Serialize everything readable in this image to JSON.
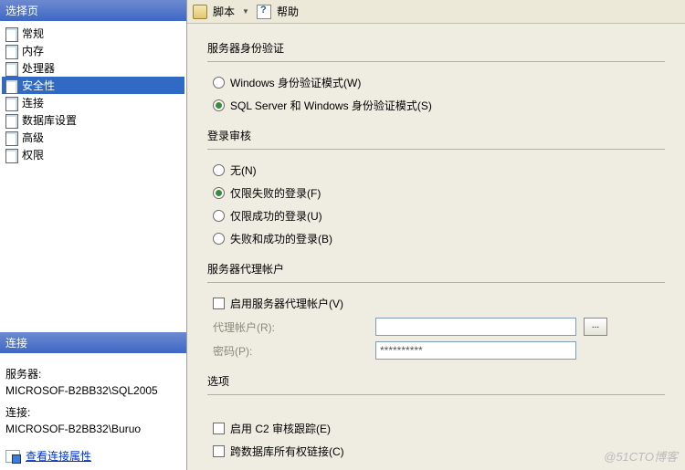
{
  "left": {
    "select_page_header": "选择页",
    "items": [
      "常规",
      "内存",
      "处理器",
      "安全性",
      "连接",
      "数据库设置",
      "高级",
      "权限"
    ],
    "selected_index": 3,
    "connect_header": "连接",
    "server_label": "服务器:",
    "server_value": "MICROSOF-B2BB32\\SQL2005",
    "conn_label": "连接:",
    "conn_value": "MICROSOF-B2BB32\\Buruo",
    "view_props": "查看连接属性"
  },
  "toolbar": {
    "script": "脚本",
    "help": "帮助"
  },
  "auth": {
    "title": "服务器身份验证",
    "windows": "Windows 身份验证模式(W)",
    "mixed": "SQL Server 和 Windows 身份验证模式(S)"
  },
  "audit": {
    "title": "登录审核",
    "none": "无(N)",
    "failed": "仅限失败的登录(F)",
    "success": "仅限成功的登录(U)",
    "both": "失败和成功的登录(B)"
  },
  "proxy": {
    "title": "服务器代理帐户",
    "enable": "启用服务器代理帐户(V)",
    "account_label": "代理帐户(R):",
    "password_label": "密码(P):",
    "password_mask": "**********",
    "browse": "..."
  },
  "options": {
    "title": "选项",
    "c2": "启用 C2 审核跟踪(E)",
    "cross": "跨数据库所有权链接(C)"
  },
  "watermark": "@51CTO博客"
}
